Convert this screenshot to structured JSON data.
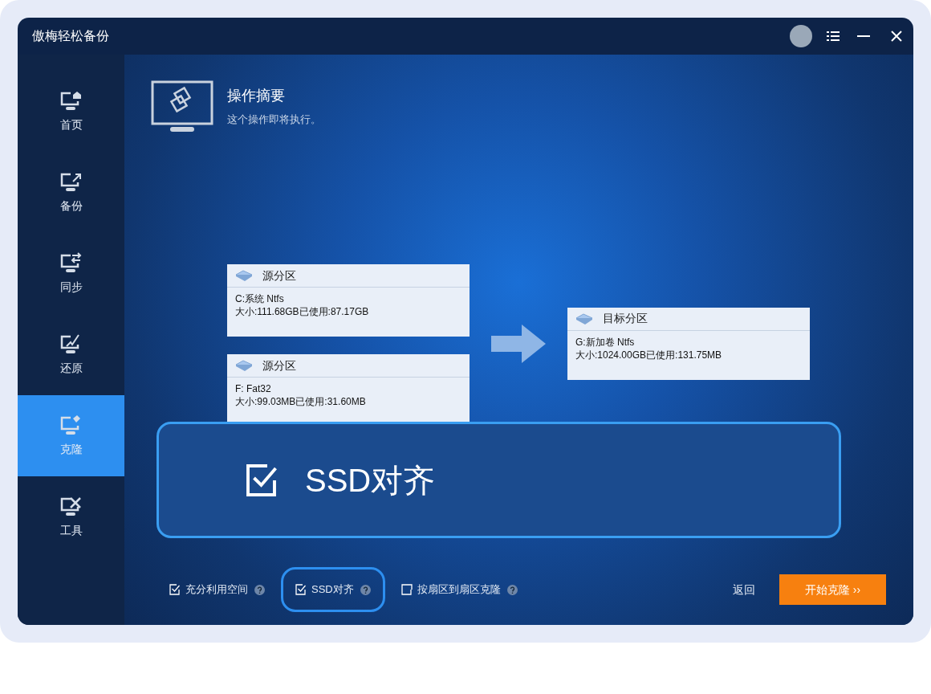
{
  "window": {
    "title": "傲梅轻松备份"
  },
  "sidebar": {
    "items": [
      {
        "label": "首页",
        "selected": false
      },
      {
        "label": "备份",
        "selected": false
      },
      {
        "label": "同步",
        "selected": false
      },
      {
        "label": "还原",
        "selected": false
      },
      {
        "label": "克隆",
        "selected": true
      },
      {
        "label": "工具",
        "selected": false
      }
    ]
  },
  "header": {
    "title": "操作摘要",
    "subtitle": "这个操作即将执行。"
  },
  "sources": [
    {
      "heading": "源分区",
      "name": "C:系统 Ntfs",
      "size": "大小:111.68GB已使用:87.17GB"
    },
    {
      "heading": "源分区",
      "name": "F: Fat32",
      "size": "大小:99.03MB已使用:31.60MB"
    }
  ],
  "target": {
    "heading": "目标分区",
    "name": "G:新加卷 Ntfs",
    "size": "大小:1024.00GB已使用:131.75MB"
  },
  "options": [
    {
      "label": "充分利用空间",
      "checked": true,
      "highlighted": false
    },
    {
      "label": "SSD对齐",
      "checked": true,
      "highlighted": true
    },
    {
      "label": "按扇区到扇区克隆",
      "checked": false,
      "highlighted": false
    }
  ],
  "callout": {
    "label": "SSD对齐",
    "checked": true
  },
  "buttons": {
    "back": "返回",
    "start": "开始克隆 ››"
  }
}
